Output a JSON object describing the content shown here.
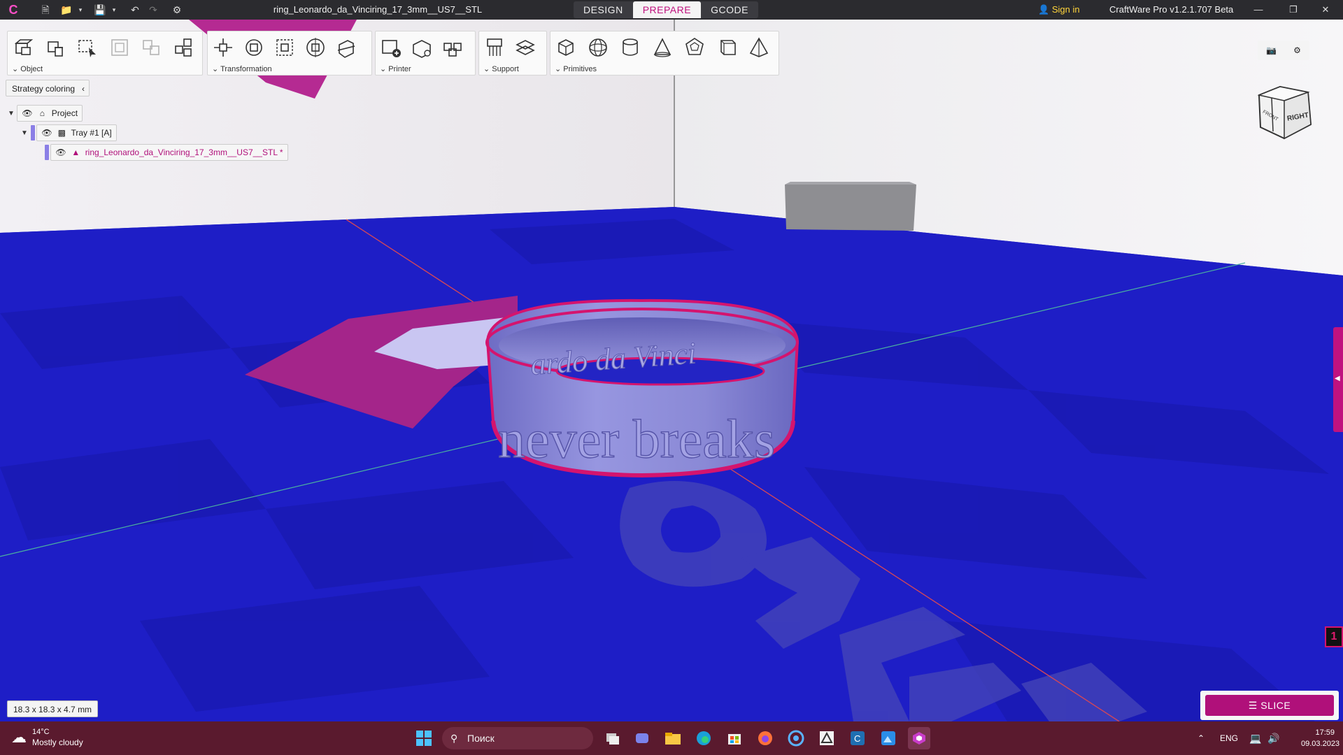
{
  "titlebar": {
    "doc_title": "ring_Leonardo_da_Vinciring_17_3mm__US7__STL",
    "tabs": [
      {
        "label": "DESIGN",
        "active": false
      },
      {
        "label": "PREPARE",
        "active": true
      },
      {
        "label": "GCODE",
        "active": false
      }
    ],
    "sign_in": "Sign in",
    "app_version": "CraftWare Pro v1.2.1.707 Beta",
    "window_controls": [
      "minimize-icon",
      "restore-icon",
      "close-icon"
    ]
  },
  "toolbar": {
    "groups": [
      {
        "label": "Object",
        "icons": [
          "add-object-icon",
          "delete-object-icon",
          "select-icon",
          "frame-icon",
          "duplicate-icon",
          "arrange-icon"
        ]
      },
      {
        "label": "Transformation",
        "icons": [
          "move-icon",
          "rotate-icon",
          "scale-icon",
          "mirror-icon",
          "cut-icon"
        ]
      },
      {
        "label": "Printer",
        "icons": [
          "add-printer-icon",
          "printer-settings-icon",
          "multi-printer-icon"
        ]
      },
      {
        "label": "Support",
        "icons": [
          "auto-support-icon",
          "manual-support-icon"
        ]
      },
      {
        "label": "Primitives",
        "icons": [
          "cube-icon",
          "sphere-icon",
          "cylinder-icon",
          "cone-icon",
          "dodecahedron-icon",
          "prism-icon",
          "pyramid-icon"
        ]
      }
    ]
  },
  "strategy_coloring": "Strategy coloring",
  "tree": {
    "project": "Project",
    "tray": "Tray #1 [A]",
    "object": "ring_Leonardo_da_Vinciring_17_3mm__US7__STL *"
  },
  "viewport": {
    "viewcube_labels": [
      "FRONT",
      "RIGHT"
    ],
    "ring_text_top": "ardo da Vinci",
    "ring_text_front": "never breaks",
    "layer_badge": "1",
    "dimensions": "18.3 x 18.3 x 4.7 mm",
    "slice_label": "SLICE",
    "colors": {
      "bed": "#1d1dc4",
      "accent": "#b0107a",
      "ring": "#8c8bd8"
    }
  },
  "taskbar": {
    "weather_temp": "14°C",
    "weather_condition": "Mostly cloudy",
    "search_placeholder": "Поиск",
    "language": "ENG",
    "time": "17:59",
    "date": "09.03.2023"
  }
}
